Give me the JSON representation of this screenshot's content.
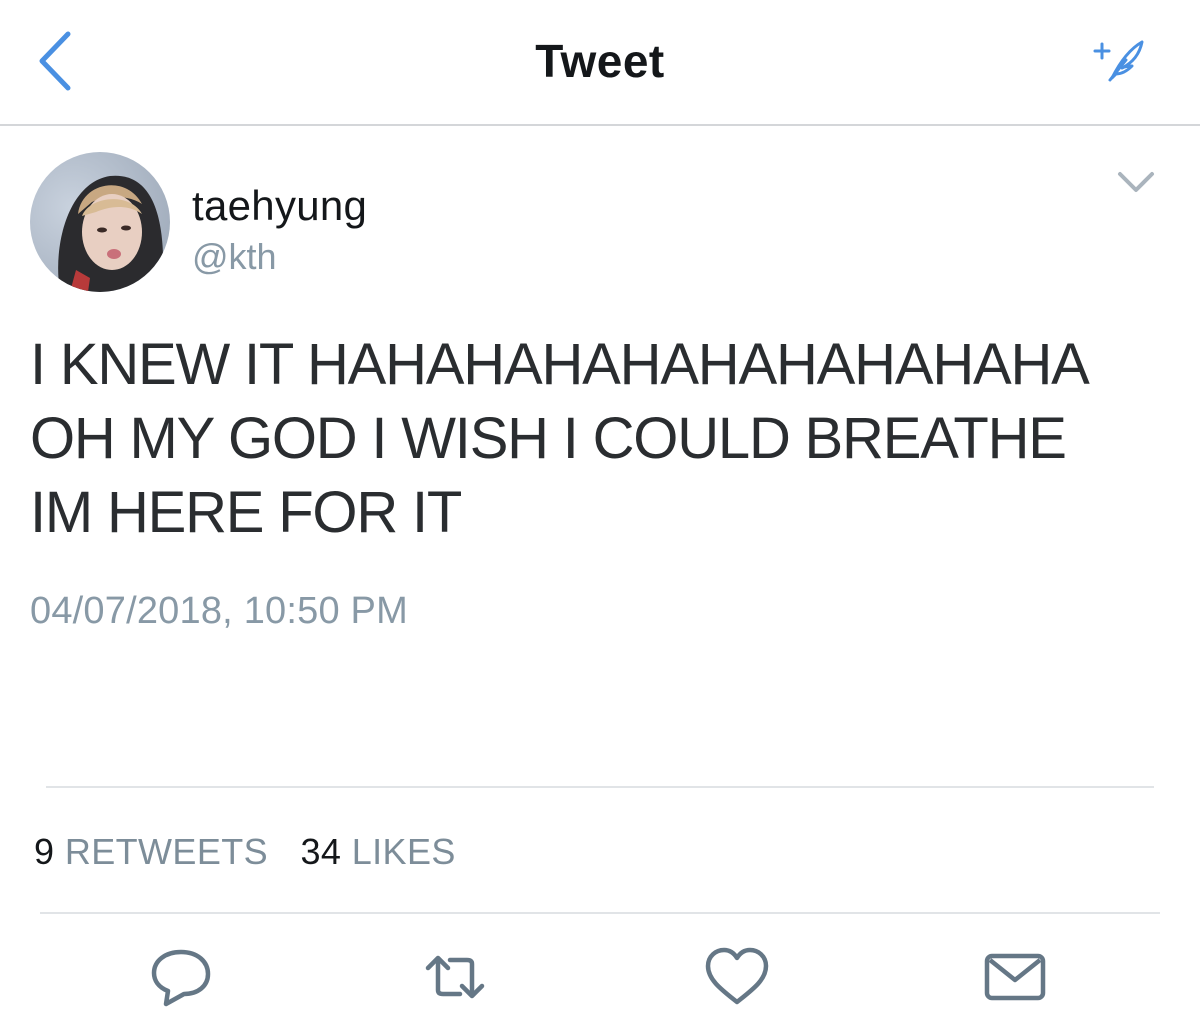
{
  "header": {
    "title": "Tweet",
    "back_icon": "chevron-left-icon",
    "compose_icon": "compose-feather-icon"
  },
  "tweet": {
    "author": {
      "display_name": "taehyung",
      "handle": "@kth"
    },
    "text_lines": [
      "I KNEW IT HAHAHAHAHAHAHAHAHAHA",
      "OH MY GOD I WISH I COULD BREATHE",
      "IM HERE FOR IT"
    ],
    "timestamp": "04/07/2018, 10:50 PM",
    "stats": {
      "retweets_count": "9",
      "retweets_label": "RETWEETS",
      "likes_count": "34",
      "likes_label": "LIKES"
    }
  },
  "actions": [
    {
      "name": "reply-button",
      "icon": "reply-bubble-icon"
    },
    {
      "name": "retweet-button",
      "icon": "retweet-icon"
    },
    {
      "name": "like-button",
      "icon": "heart-icon"
    },
    {
      "name": "share-button",
      "icon": "envelope-icon"
    }
  ],
  "colors": {
    "accent": "#4a90e2",
    "text_primary": "#14171a",
    "text_secondary": "#8899a6",
    "divider": "#e1e4e7"
  }
}
